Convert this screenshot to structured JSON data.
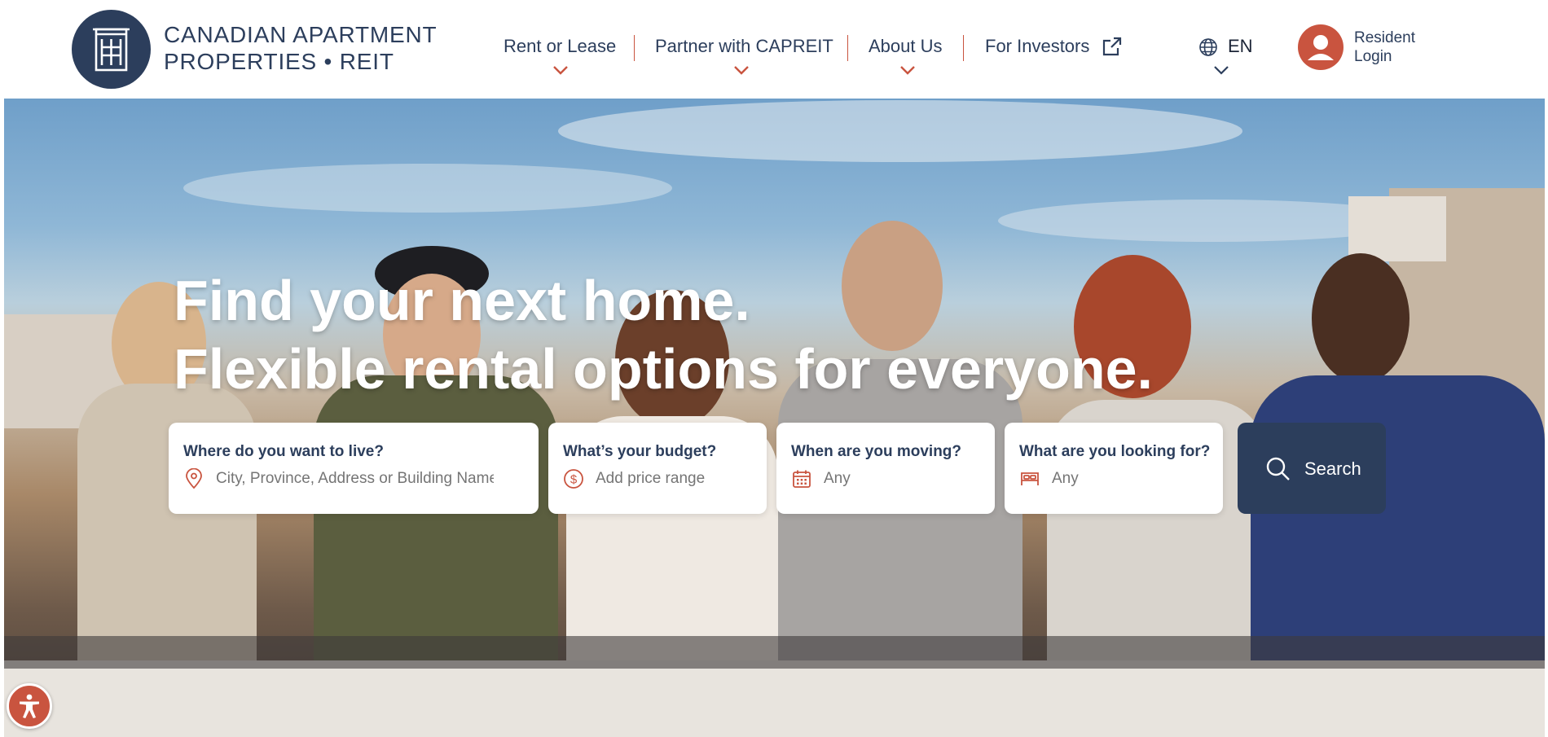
{
  "colors": {
    "brand_navy": "#2c3e5c",
    "accent_red": "#c9543f",
    "white": "#ffffff"
  },
  "brand": {
    "line1": "CANADIAN APARTMENT",
    "line2": "PROPERTIES • REIT",
    "logo_icon": "building-door-icon"
  },
  "nav": {
    "items": [
      {
        "label": "Rent or Lease",
        "has_dropdown": true
      },
      {
        "label": "Partner with CAPREIT",
        "has_dropdown": true
      },
      {
        "label": "About Us",
        "has_dropdown": true
      },
      {
        "label": "For Investors",
        "icon": "external-link-icon"
      }
    ],
    "language": {
      "label": "EN",
      "icon": "globe-icon"
    },
    "resident_login": {
      "label": "Resident Login",
      "icon": "user-avatar-icon"
    }
  },
  "hero": {
    "headline_line1": "Find your next home.",
    "headline_line2": "Flexible rental options for everyone."
  },
  "search": {
    "fields": [
      {
        "label": "Where do you want to live?",
        "placeholder": "City, Province, Address or Building Name",
        "icon": "map-pin-icon"
      },
      {
        "label": "What’s your budget?",
        "placeholder": "Add price range",
        "icon": "dollar-circle-icon"
      },
      {
        "label": "When are you moving?",
        "placeholder": "Any",
        "icon": "calendar-icon"
      },
      {
        "label": "What are you looking for?",
        "placeholder": "Any",
        "icon": "bed-icon"
      }
    ],
    "button_label": "Search",
    "button_icon": "search-icon"
  },
  "accessibility": {
    "icon": "accessibility-icon"
  }
}
